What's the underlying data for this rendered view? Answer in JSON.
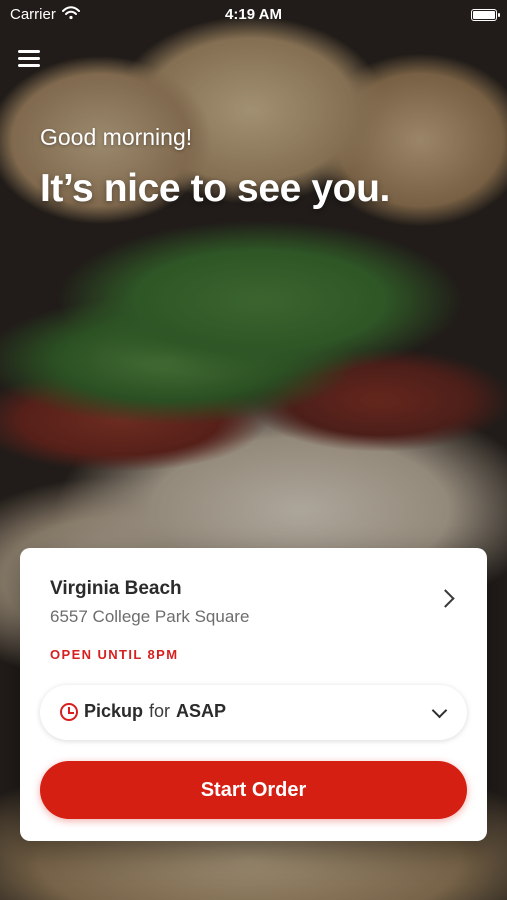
{
  "status_bar": {
    "carrier": "Carrier",
    "time": "4:19 AM",
    "icons": [
      "wifi-icon",
      "battery-icon"
    ]
  },
  "header": {
    "menu_icon": "hamburger-menu-icon"
  },
  "greeting": {
    "subtitle": "Good morning!",
    "title": "It’s nice to see you."
  },
  "location_card": {
    "name": "Virginia Beach",
    "address": "6557 College Park Square",
    "hours": "OPEN UNTIL 8PM",
    "pickup": {
      "mode": "Pickup",
      "connector": "for",
      "time": "ASAP"
    },
    "cta_label": "Start Order",
    "colors": {
      "accent": "#d61f13",
      "hours_text": "#d71f1f"
    }
  }
}
